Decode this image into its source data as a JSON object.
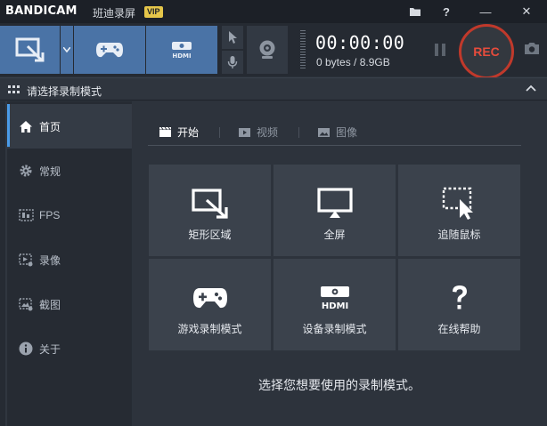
{
  "app": {
    "brand": "BANDICAM",
    "subtitle": "班迪录屏",
    "vip_badge": "VIP"
  },
  "title_controls": [
    "folder-icon",
    "help-icon",
    "minimize-icon",
    "close-icon"
  ],
  "title_help": "?",
  "title_min": "—",
  "title_close": "✕",
  "toolbar": {
    "timer": "00:00:00",
    "size": "0 bytes / 8.9GB",
    "rec_label": "REC"
  },
  "section": {
    "title": "请选择录制模式"
  },
  "sidebar": {
    "items": [
      {
        "label": "首页",
        "icon": "home-icon"
      },
      {
        "label": "常规",
        "icon": "gear-icon"
      },
      {
        "label": "FPS",
        "icon": "fps-icon"
      },
      {
        "label": "录像",
        "icon": "video-settings-icon"
      },
      {
        "label": "截图",
        "icon": "image-settings-icon"
      },
      {
        "label": "关于",
        "icon": "info-icon"
      }
    ],
    "active_index": 0
  },
  "tabs": [
    {
      "label": "开始",
      "icon": "clapper-icon"
    },
    {
      "label": "视频",
      "icon": "play-icon"
    },
    {
      "label": "图像",
      "icon": "picture-icon"
    }
  ],
  "tiles": [
    {
      "label": "矩形区域",
      "icon": "rectangle-area-icon"
    },
    {
      "label": "全屏",
      "icon": "monitor-icon"
    },
    {
      "label": "追随鼠标",
      "icon": "follow-cursor-icon"
    },
    {
      "label": "游戏录制模式",
      "icon": "gamepad-icon"
    },
    {
      "label": "设备录制模式",
      "icon": "hdmi-icon"
    },
    {
      "label": "在线帮助",
      "icon": "question-icon"
    }
  ],
  "hint": "选择您想要使用的录制模式。",
  "colors": {
    "accent_blue": "#4a73a6",
    "rec_red": "#e74c3c",
    "vip_gold": "#e5c64a"
  }
}
